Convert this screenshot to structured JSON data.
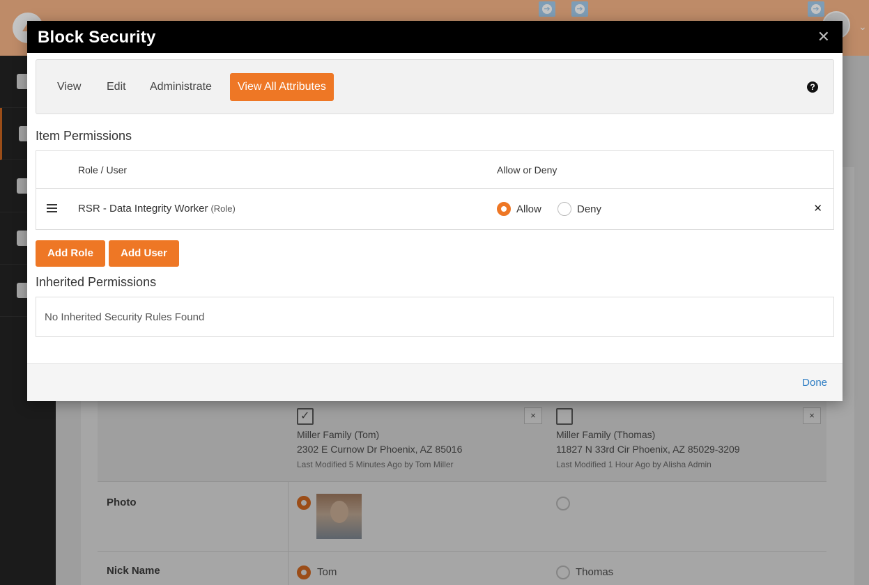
{
  "colors": {
    "accent": "#ee7725",
    "link": "#2c7cc3",
    "modal_header": "#000000"
  },
  "modal": {
    "title": "Block Security",
    "close_icon": "close-icon"
  },
  "tabs": [
    {
      "label": "View",
      "active": false
    },
    {
      "label": "Edit",
      "active": false
    },
    {
      "label": "Administrate",
      "active": false
    },
    {
      "label": "View All Attributes",
      "active": true
    }
  ],
  "help_icon": "question-circle-icon",
  "item_permissions": {
    "title": "Item Permissions",
    "columns": {
      "role_user": "Role / User",
      "allow_deny": "Allow or Deny"
    },
    "rows": [
      {
        "name": "RSR - Data Integrity Worker",
        "type": "(Role)",
        "allow_label": "Allow",
        "deny_label": "Deny",
        "selected": "Allow"
      }
    ]
  },
  "buttons": {
    "add_role": "Add Role",
    "add_user": "Add User"
  },
  "inherited_permissions": {
    "title": "Inherited Permissions",
    "empty_message": "No Inherited Security Rules Found"
  },
  "footer": {
    "done_label": "Done"
  },
  "background": {
    "families": [
      {
        "name": "Miller Family (Tom)",
        "address": "2302 E Curnow Dr Phoenix, AZ 85016",
        "modified": "Last Modified 5 Minutes Ago by Tom Miller",
        "checked": true
      },
      {
        "name": "Miller Family (Thomas)",
        "address": "11827 N 33rd Cir Phoenix, AZ 85029-3209",
        "modified": "Last Modified 1 Hour Ago by Alisha Admin",
        "checked": false
      }
    ],
    "rows": [
      {
        "label": "Photo"
      },
      {
        "label": "Nick Name",
        "value_left": "Tom",
        "value_right": "Thomas"
      }
    ]
  }
}
